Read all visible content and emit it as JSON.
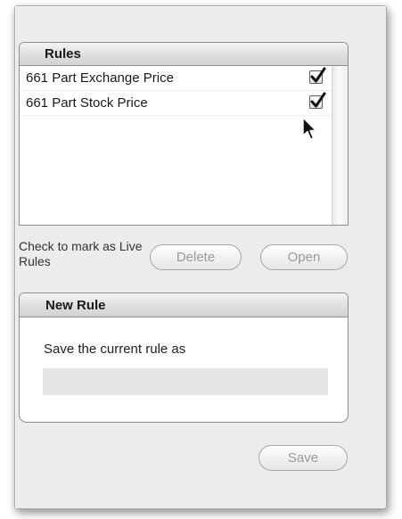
{
  "rules_panel": {
    "header": "Rules",
    "rows": [
      {
        "label": "661 Part Exchange Price",
        "checked": true
      },
      {
        "label": "661 Part Stock Price",
        "checked": true
      }
    ]
  },
  "actions": {
    "hint": "Check to mark as Live Rules",
    "delete_label": "Delete",
    "open_label": "Open"
  },
  "new_rule": {
    "header": "New Rule",
    "prompt": "Save the current rule as",
    "input_value": "",
    "save_label": "Save"
  }
}
